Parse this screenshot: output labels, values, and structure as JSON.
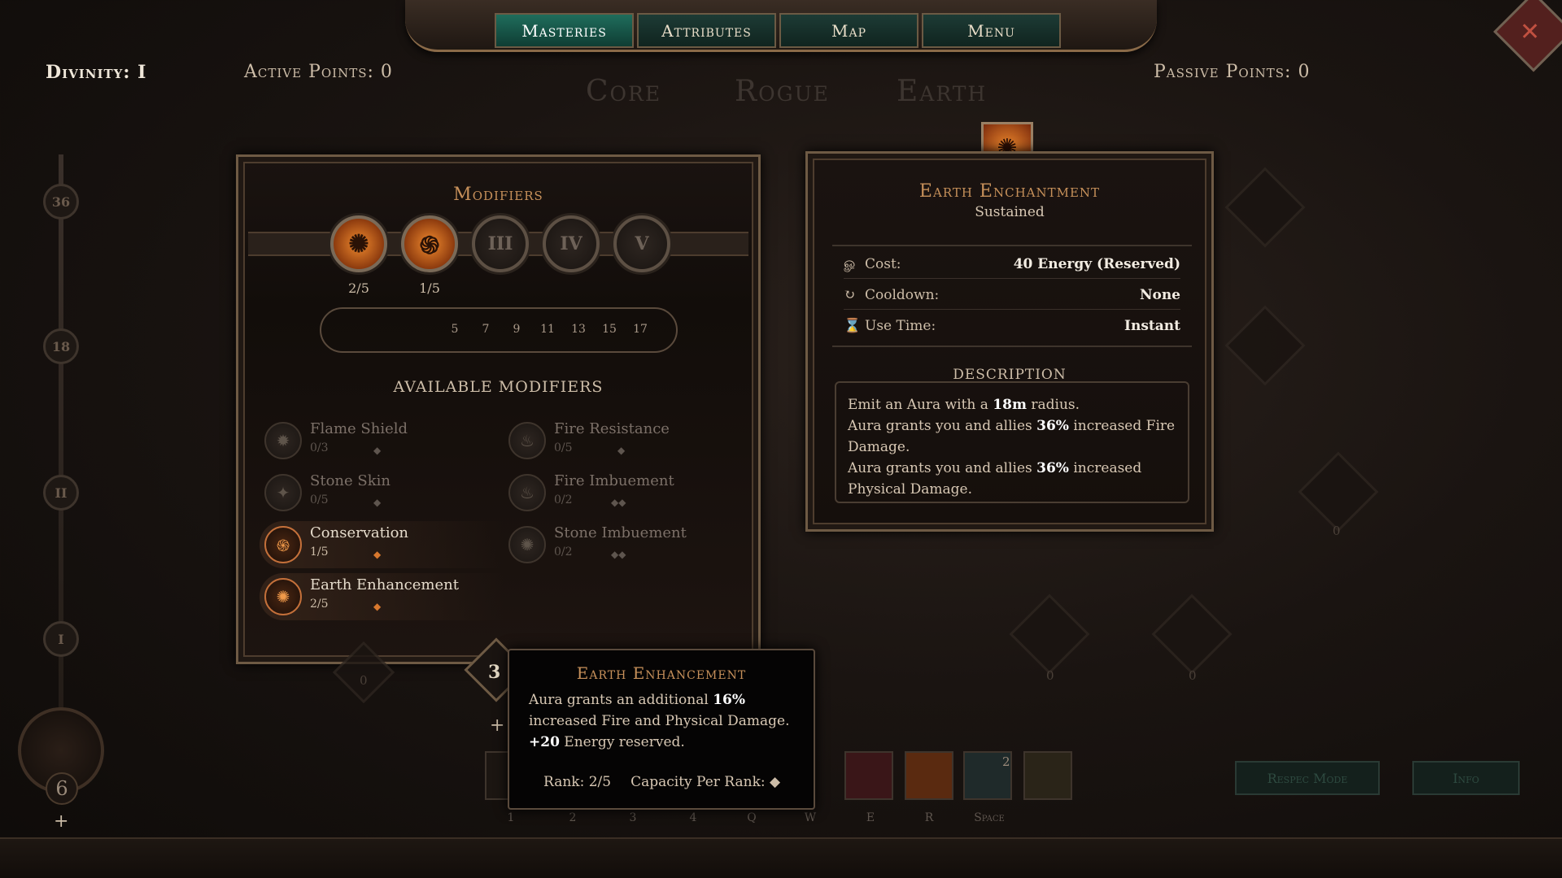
{
  "nav": {
    "tabs": [
      "Masteries",
      "Attributes",
      "Map",
      "Menu"
    ]
  },
  "header": {
    "divinity": "Divinity: I",
    "active_points": "Active Points: 0",
    "passive_points": "Passive Points: 0",
    "tree_tabs": [
      "Core",
      "Rogue",
      "Earth"
    ]
  },
  "rail": {
    "nodes": [
      "36",
      "18",
      "II",
      "I"
    ],
    "orb_value": "6",
    "plus": "+"
  },
  "modifiers": {
    "title": "Modifiers",
    "slots": [
      {
        "label": "",
        "count": "2/5",
        "filled": true
      },
      {
        "label": "",
        "count": "1/5",
        "filled": true
      },
      {
        "label": "III",
        "count": ""
      },
      {
        "label": "IV",
        "count": ""
      },
      {
        "label": "V",
        "count": ""
      }
    ],
    "capacity": [
      "",
      "",
      "",
      "5",
      "7",
      "9",
      "11",
      "13",
      "15",
      "17"
    ],
    "capacity_filled": 3,
    "available_label": "AVAILABLE MODIFIERS",
    "items": [
      {
        "name": "Flame Shield",
        "rank": "0/3"
      },
      {
        "name": "Fire Resistance",
        "rank": "0/5"
      },
      {
        "name": "Stone Skin",
        "rank": "0/5"
      },
      {
        "name": "Fire Imbuement",
        "rank": "0/2"
      },
      {
        "name": "Conservation",
        "rank": "1/5"
      },
      {
        "name": "Stone Imbuement",
        "rank": "0/2"
      },
      {
        "name": "Earth Enhancement",
        "rank": "2/5"
      }
    ]
  },
  "enchantment": {
    "title": "Earth Enchantment",
    "subtitle": "Sustained",
    "stats": [
      {
        "label": "Cost:",
        "value": "40 Energy (Reserved)"
      },
      {
        "label": "Cooldown:",
        "value": "None"
      },
      {
        "label": "Use Time:",
        "value": "Instant"
      }
    ],
    "description_label": "DESCRIPTION",
    "description": {
      "l1a": "Emit an Aura with a ",
      "l1b": "18m",
      "l1c": " radius.",
      "l2a": "Aura grants you and allies ",
      "l2b": "36%",
      "l2c": " increased Fire Damage.",
      "l3a": "Aura grants you and allies ",
      "l3b": "36%",
      "l3c": " increased Physical Damage."
    }
  },
  "tooltip": {
    "rank_badge": "3",
    "plus": "+",
    "title": "Earth Enhancement",
    "line1a": "Aura grants an additional ",
    "line1b": "16%",
    "line1c": " increased Fire and Physical Damage.",
    "line2a": "+20",
    "line2b": " Energy reserved.",
    "rank": "Rank: 2/5",
    "capacity": "Capacity Per Rank:"
  },
  "right_nodes": [
    "0",
    "0",
    "0",
    "0"
  ],
  "left_node_value": "0",
  "hotbar": {
    "keys": [
      "1",
      "2",
      "3",
      "4",
      "Q",
      "W",
      "E",
      "R",
      "Space"
    ],
    "extra_badge": "2"
  },
  "bottom_buttons": {
    "respec": "Respec Mode",
    "info": "Info"
  },
  "colors": {
    "accent_orange": "#f08a2e",
    "nav_active": "#1f6d5c",
    "title_bronze": "#c6905a"
  }
}
